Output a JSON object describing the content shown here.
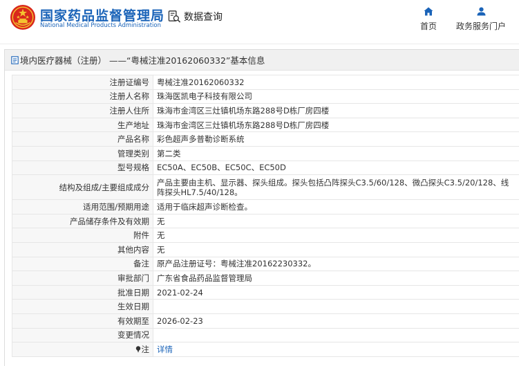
{
  "header": {
    "brand_cn": "国家药品监督管理局",
    "brand_en": "National Medical Products Administration",
    "page_label": "数据查询",
    "nav": [
      {
        "label": "首页",
        "icon": "home-icon"
      },
      {
        "label": "政务服务门户",
        "icon": "user-icon"
      }
    ]
  },
  "panel": {
    "breadcrumb": "境内医疗器械（注册） ——“粤械注准20162060332”基本信息"
  },
  "detail": {
    "rows": [
      {
        "label": "注册证编号",
        "value": "粤械注准20162060332"
      },
      {
        "label": "注册人名称",
        "value": "珠海医凯电子科技有限公司"
      },
      {
        "label": "注册人住所",
        "value": "珠海市金湾区三灶镇机场东路288号D栋厂房四楼"
      },
      {
        "label": "生产地址",
        "value": "珠海市金湾区三灶镇机场东路288号D栋厂房四楼"
      },
      {
        "label": "产品名称",
        "value": "彩色超声多普勒诊断系统"
      },
      {
        "label": "管理类别",
        "value": "第二类"
      },
      {
        "label": "型号规格",
        "value": "EC50A、EC50B、EC50C、EC50D"
      },
      {
        "label": "结构及组成/主要组成成分",
        "value": "产品主要由主机、显示器、探头组成。探头包括凸阵探头C3.5/60/128、微凸探头C3.5/20/128、线阵探头HL7.5/40/128。"
      },
      {
        "label": "适用范围/预期用途",
        "value": "适用于临床超声诊断检查。"
      },
      {
        "label": "产品储存条件及有效期",
        "value": "无"
      },
      {
        "label": "附件",
        "value": "无"
      },
      {
        "label": "其他内容",
        "value": "无"
      },
      {
        "label": "备注",
        "value": "原产品注册证号：粤械注准20162230332。"
      },
      {
        "label": "审批部门",
        "value": "广东省食品药品监督管理局"
      },
      {
        "label": "批准日期",
        "value": "2021-02-24"
      },
      {
        "label": "生效日期",
        "value": ""
      },
      {
        "label": "有效期至",
        "value": "2026-02-23"
      },
      {
        "label": "变更情况",
        "value": ""
      }
    ],
    "note_label": "注",
    "note_link": "详情"
  },
  "colors": {
    "brand_blue": "#1a63b8",
    "label_bg": "#f7f7f7",
    "panel_head_bg": "#f0f0f0"
  }
}
